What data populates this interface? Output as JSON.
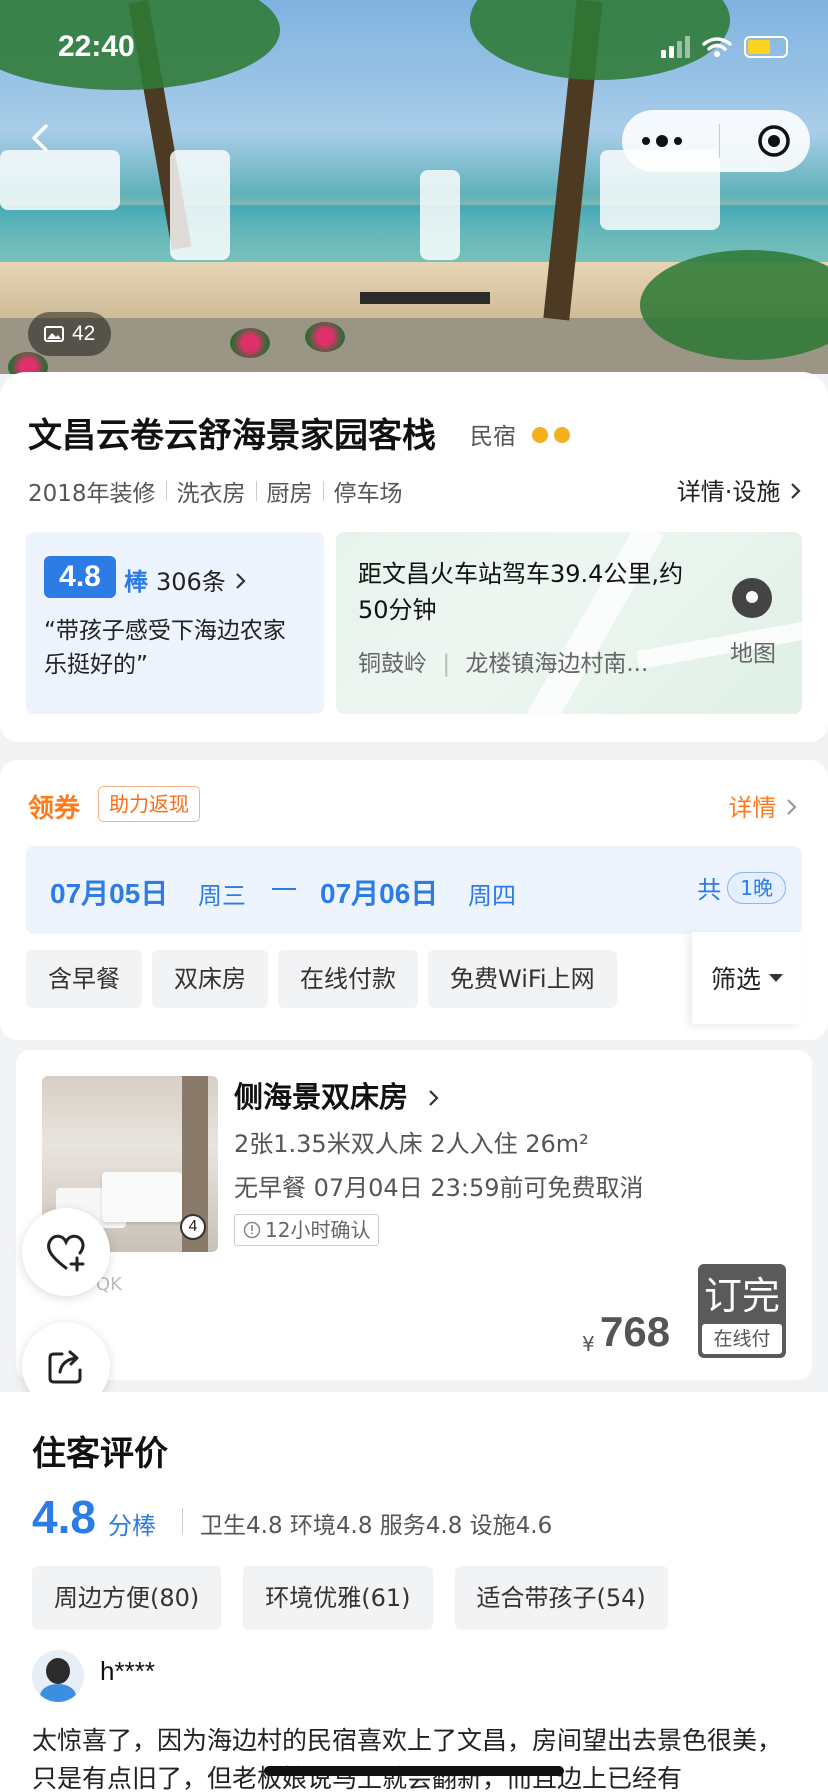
{
  "status": {
    "time": "22:40"
  },
  "hero": {
    "photo_count": "42"
  },
  "hotel": {
    "name": "文昌云卷云舒海景家园客栈",
    "type": "民宿",
    "facilities": [
      "2018年装修",
      "洗衣房",
      "厨房",
      "停车场"
    ],
    "detail_link": "详情·设施"
  },
  "rating": {
    "score": "4.8",
    "word": "棒",
    "count": "306条",
    "quote": "“带孩子感受下海边农家乐挺好的”"
  },
  "location": {
    "distance": "距文昌火车站驾车39.4公里,约50分钟",
    "area": "铜鼓岭",
    "address": "龙楼镇海边村南...",
    "map_label": "地图"
  },
  "booking": {
    "coupon": "领券",
    "coupon_tag": "助力返现",
    "detail": "详情",
    "checkin_date": "07月05日",
    "checkin_weekday": "周三",
    "checkout_date": "07月06日",
    "checkout_weekday": "周四",
    "total_prefix": "共",
    "nights": "1晚",
    "chips": [
      "含早餐",
      "双床房",
      "在线付款",
      "免费WiFi上网"
    ],
    "filter": "筛选"
  },
  "room": {
    "name": "侧海景双床房",
    "spec": "2张1.35米双人床  2人入住  26m²",
    "policy": "无早餐  07月04日 23:59前可免费取消",
    "confirm": "12小时确认",
    "photo_count": "4",
    "watermark": "QK",
    "currency": "¥",
    "price": "768",
    "book_label": "订完",
    "pay_label": "在线付"
  },
  "reviews": {
    "title": "住客评价",
    "score": "4.8",
    "unit": "分棒",
    "subscores": "卫生4.8  环境4.8  服务4.8  设施4.6",
    "tags": [
      "周边方便(80)",
      "环境优雅(61)",
      "适合带孩子(54)"
    ],
    "user": "h****",
    "text": "太惊喜了，因为海边村的民宿喜欢上了文昌，房间望出去景色很美，只是有点旧了，但老板娘说马上就会翻新，而且边上已经有"
  }
}
